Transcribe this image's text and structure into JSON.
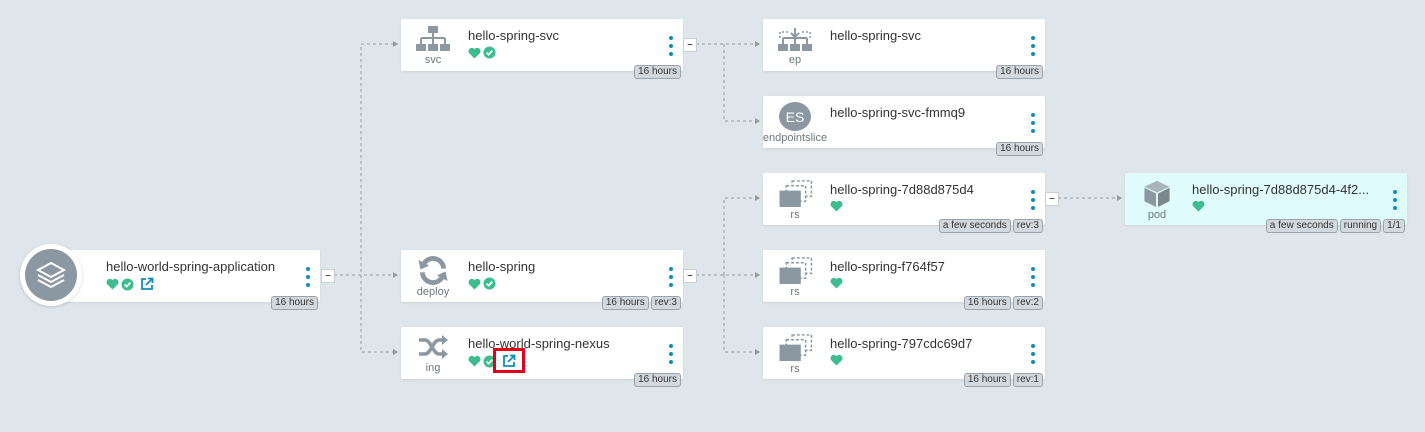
{
  "colors": {
    "background": "#dee6eb",
    "status_green": "#3dbd8d",
    "link_blue": "#0f8fb8",
    "icon_gray": "#8c98a1",
    "pod_bg": "#e0fbfb",
    "highlight": "#e3001b"
  },
  "app": {
    "name": "hello-world-spring-application",
    "badges": [
      "16 hours"
    ],
    "icon": "layers-icon",
    "status_icons": [
      "heart-icon",
      "check-circle-icon",
      "external-link-icon"
    ]
  },
  "nodes": {
    "svc": {
      "kind": "svc",
      "name": "hello-spring-svc",
      "badges": [
        "16 hours"
      ],
      "icon": "network-icon",
      "status_icons": [
        "heart-icon",
        "check-circle-icon"
      ]
    },
    "deploy": {
      "kind": "deploy",
      "name": "hello-spring",
      "badges": [
        "16 hours",
        "rev:3"
      ],
      "icon": "sync-icon",
      "status_icons": [
        "heart-icon",
        "check-circle-icon"
      ]
    },
    "ing": {
      "kind": "ing",
      "name": "hello-world-spring-nexus",
      "badges": [
        "16 hours"
      ],
      "icon": "random-icon",
      "status_icons": [
        "heart-icon",
        "check-circle-icon",
        "external-link-icon"
      ]
    },
    "ep": {
      "kind": "ep",
      "name": "hello-spring-svc",
      "badges": [
        "16 hours"
      ],
      "icon": "endpoints-icon"
    },
    "endpointslice": {
      "kind": "endpointslice",
      "icon_text": "ES",
      "name": "hello-spring-svc-fmmq9",
      "badges": [
        "16 hours"
      ]
    },
    "rs1": {
      "kind": "rs",
      "name": "hello-spring-7d88d875d4",
      "badges": [
        "a few seconds",
        "rev:3"
      ],
      "icon": "replicaset-icon",
      "status_icons": [
        "heart-icon"
      ]
    },
    "rs2": {
      "kind": "rs",
      "name": "hello-spring-f764f57",
      "badges": [
        "16 hours",
        "rev:2"
      ],
      "icon": "replicaset-icon",
      "status_icons": [
        "heart-icon"
      ]
    },
    "rs3": {
      "kind": "rs",
      "name": "hello-spring-797cdc69d7",
      "badges": [
        "16 hours",
        "rev:1"
      ],
      "icon": "replicaset-icon",
      "status_icons": [
        "heart-icon"
      ]
    },
    "pod": {
      "kind": "pod",
      "name": "hello-spring-7d88d875d4-4f2...",
      "badges": [
        "a few seconds",
        "running",
        "1/1"
      ],
      "icon": "cube-icon",
      "status_icons": [
        "heart-icon"
      ]
    }
  },
  "collapse_symbol": "–"
}
